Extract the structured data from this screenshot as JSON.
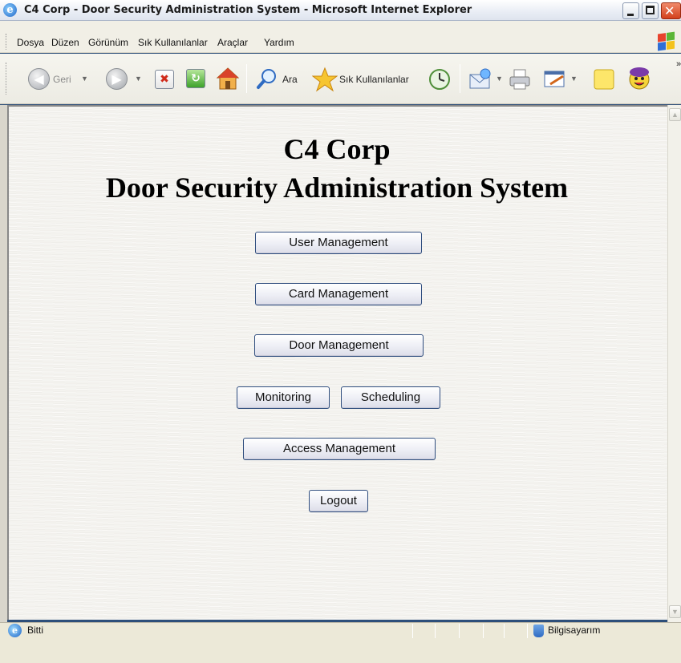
{
  "window": {
    "title": "C4 Corp - Door Security Administration System - Microsoft Internet Explorer",
    "controls": {
      "minimize": "minimize-icon",
      "maximize": "restore-icon",
      "close": "close-icon"
    }
  },
  "menu": {
    "items": [
      "Dosya",
      "Düzen",
      "Görünüm",
      "Sık Kullanılanlar",
      "Araçlar",
      "Yardım"
    ]
  },
  "toolbar": {
    "back_label": "Geri",
    "search_label": "Ara",
    "favorites_label": "Sık Kullanılanlar",
    "icons": [
      "back-icon",
      "forward-icon",
      "stop-icon",
      "refresh-icon",
      "home-icon",
      "search-icon",
      "favorites-star-icon",
      "history-icon",
      "mail-icon",
      "print-icon",
      "edit-icon",
      "notes-icon",
      "messenger-icon"
    ]
  },
  "page": {
    "title_line1": "C4 Corp",
    "title_line2": "Door Security Administration System",
    "buttons": {
      "user_management": "User Management",
      "card_management": "Card Management",
      "door_management": "Door Management",
      "monitoring": "Monitoring",
      "scheduling": "Scheduling",
      "access_management": "Access Management",
      "logout": "Logout"
    }
  },
  "status": {
    "text": "Bitti",
    "zone": "Bilgisayarım"
  }
}
